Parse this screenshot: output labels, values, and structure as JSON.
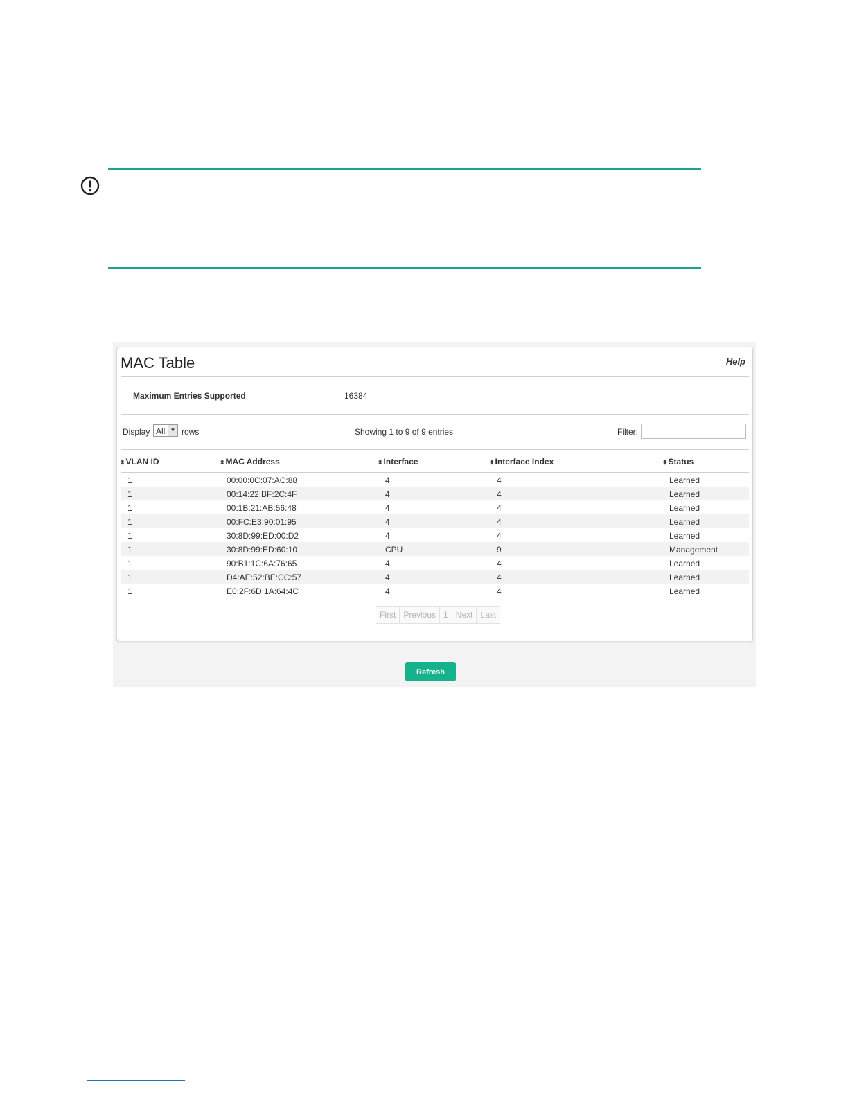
{
  "page_title": "MAC Table",
  "help_label": "Help",
  "max_entries": {
    "label": "Maximum Entries Supported",
    "value": "16384"
  },
  "display": {
    "label": "Display",
    "selected": "All",
    "suffix": "rows"
  },
  "showing_text": "Showing 1 to 9 of 9 entries",
  "filter": {
    "label": "Filter:",
    "value": "",
    "placeholder": ""
  },
  "columns": [
    "VLAN ID",
    "MAC Address",
    "Interface",
    "Interface Index",
    "Status"
  ],
  "rows": [
    {
      "vlan": "1",
      "mac": "00:00:0C:07:AC:88",
      "interface": "4",
      "index": "4",
      "status": "Learned"
    },
    {
      "vlan": "1",
      "mac": "00:14:22:BF:2C:4F",
      "interface": "4",
      "index": "4",
      "status": "Learned"
    },
    {
      "vlan": "1",
      "mac": "00:1B:21:AB:56:48",
      "interface": "4",
      "index": "4",
      "status": "Learned"
    },
    {
      "vlan": "1",
      "mac": "00:FC:E3:90:01:95",
      "interface": "4",
      "index": "4",
      "status": "Learned"
    },
    {
      "vlan": "1",
      "mac": "30:8D:99:ED:00:D2",
      "interface": "4",
      "index": "4",
      "status": "Learned"
    },
    {
      "vlan": "1",
      "mac": "30:8D:99:ED:60:10",
      "interface": "CPU",
      "index": "9",
      "status": "Management"
    },
    {
      "vlan": "1",
      "mac": "90:B1:1C:6A:76:65",
      "interface": "4",
      "index": "4",
      "status": "Learned"
    },
    {
      "vlan": "1",
      "mac": "D4:AE:52:BE:CC:57",
      "interface": "4",
      "index": "4",
      "status": "Learned"
    },
    {
      "vlan": "1",
      "mac": "E0:2F:6D:1A:64:4C",
      "interface": "4",
      "index": "4",
      "status": "Learned"
    }
  ],
  "pagination": {
    "first": "First",
    "previous": "Previous",
    "page": "1",
    "next": "Next",
    "last": "Last"
  },
  "refresh_label": "Refresh",
  "colors": {
    "accent": "#16b28c",
    "notice_rule": "#1aa58a"
  },
  "icons": {
    "notice": "important-icon",
    "sort": "sort-icon",
    "dropdown": "chevron-down-icon"
  }
}
